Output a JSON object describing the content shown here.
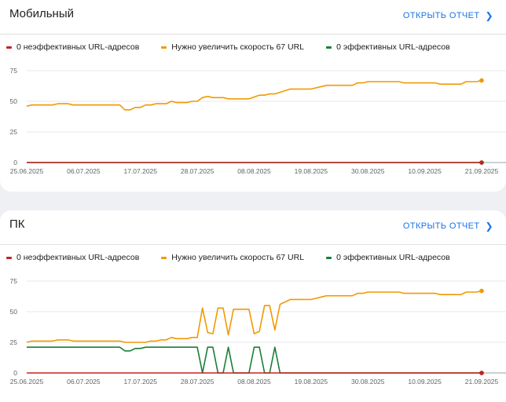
{
  "colors": {
    "red": "#c5221f",
    "orange": "#f29900",
    "green": "#188038",
    "link": "#1a73e8"
  },
  "cards": [
    {
      "title": "Мобильный",
      "link_label": "ОТКРЫТЬ ОТЧЕТ",
      "legend": [
        {
          "label": "0 неэффективных URL-адресов",
          "color": "#c5221f"
        },
        {
          "label": "Нужно увеличить скорость 67 URL",
          "color": "#f29900"
        },
        {
          "label": "0 эффективных URL-адресов",
          "color": "#188038"
        }
      ]
    },
    {
      "title": "ПК",
      "link_label": "ОТКРЫТЬ ОТЧЕТ",
      "legend": [
        {
          "label": "0 неэффективных URL-адресов",
          "color": "#c5221f"
        },
        {
          "label": "Нужно увеличить скорость 67 URL",
          "color": "#f29900"
        },
        {
          "label": "0 эффективных URL-адресов",
          "color": "#188038"
        }
      ]
    }
  ],
  "chart_data": [
    {
      "type": "line",
      "title": "",
      "yticks": [
        0,
        25,
        50,
        75
      ],
      "ylim": [
        0,
        75
      ],
      "xlim": [
        "2025-06-25",
        "2025-09-21"
      ],
      "xticks": [
        "25.06.2025",
        "06.07.2025",
        "17.07.2025",
        "28.07.2025",
        "08.08.2025",
        "19.08.2025",
        "30.08.2025",
        "10.09.2025",
        "21.09.2025"
      ],
      "grid": true,
      "series": [
        {
          "name": "0 неэффективных URL-адресов",
          "color": "#c5221f",
          "points": [
            [
              "2025-06-25",
              0
            ],
            [
              "2025-09-21",
              0
            ]
          ]
        },
        {
          "name": "Нужно увеличить скорость 67 URL",
          "color": "#f29900",
          "points": [
            [
              "2025-06-25",
              46
            ],
            [
              "2025-06-26",
              47
            ],
            [
              "2025-06-30",
              47
            ],
            [
              "2025-07-01",
              48
            ],
            [
              "2025-07-03",
              48
            ],
            [
              "2025-07-04",
              47
            ],
            [
              "2025-07-13",
              47
            ],
            [
              "2025-07-14",
              43
            ],
            [
              "2025-07-15",
              43
            ],
            [
              "2025-07-16",
              45
            ],
            [
              "2025-07-17",
              45
            ],
            [
              "2025-07-18",
              47
            ],
            [
              "2025-07-19",
              47
            ],
            [
              "2025-07-20",
              48
            ],
            [
              "2025-07-22",
              48
            ],
            [
              "2025-07-23",
              50
            ],
            [
              "2025-07-24",
              49
            ],
            [
              "2025-07-26",
              49
            ],
            [
              "2025-07-27",
              50
            ],
            [
              "2025-07-28",
              50
            ],
            [
              "2025-07-29",
              53
            ],
            [
              "2025-07-30",
              54
            ],
            [
              "2025-07-31",
              53
            ],
            [
              "2025-08-02",
              53
            ],
            [
              "2025-08-03",
              52
            ],
            [
              "2025-08-07",
              52
            ],
            [
              "2025-08-09",
              55
            ],
            [
              "2025-08-10",
              55
            ],
            [
              "2025-08-11",
              56
            ],
            [
              "2025-08-12",
              56
            ],
            [
              "2025-08-15",
              60
            ],
            [
              "2025-08-19",
              60
            ],
            [
              "2025-08-22",
              63
            ],
            [
              "2025-08-27",
              63
            ],
            [
              "2025-08-28",
              65
            ],
            [
              "2025-08-29",
              65
            ],
            [
              "2025-08-30",
              66
            ],
            [
              "2025-09-05",
              66
            ],
            [
              "2025-09-06",
              65
            ],
            [
              "2025-09-12",
              65
            ],
            [
              "2025-09-13",
              64
            ],
            [
              "2025-09-17",
              64
            ],
            [
              "2025-09-18",
              66
            ],
            [
              "2025-09-20",
              66
            ],
            [
              "2025-09-21",
              67
            ]
          ]
        },
        {
          "name": "0 эффективных URL-адресов",
          "color": "#188038",
          "points": [
            [
              "2025-06-25",
              0
            ],
            [
              "2025-09-21",
              0
            ]
          ]
        }
      ]
    },
    {
      "type": "line",
      "title": "",
      "yticks": [
        0,
        25,
        50,
        75
      ],
      "ylim": [
        0,
        75
      ],
      "xlim": [
        "2025-06-25",
        "2025-09-21"
      ],
      "xticks": [
        "25.06.2025",
        "06.07.2025",
        "17.07.2025",
        "28.07.2025",
        "08.08.2025",
        "19.08.2025",
        "30.08.2025",
        "10.09.2025",
        "21.09.2025"
      ],
      "grid": true,
      "series": [
        {
          "name": "0 неэффективных URL-адресов",
          "color": "#c5221f",
          "points": [
            [
              "2025-06-25",
              0
            ],
            [
              "2025-09-21",
              0
            ]
          ]
        },
        {
          "name": "Нужно увеличить скорость 67 URL",
          "color": "#f29900",
          "points": [
            [
              "2025-06-25",
              25
            ],
            [
              "2025-06-26",
              26
            ],
            [
              "2025-06-30",
              26
            ],
            [
              "2025-07-01",
              27
            ],
            [
              "2025-07-03",
              27
            ],
            [
              "2025-07-04",
              26
            ],
            [
              "2025-07-13",
              26
            ],
            [
              "2025-07-14",
              25
            ],
            [
              "2025-07-18",
              25
            ],
            [
              "2025-07-19",
              26
            ],
            [
              "2025-07-20",
              26
            ],
            [
              "2025-07-21",
              27
            ],
            [
              "2025-07-22",
              27
            ],
            [
              "2025-07-23",
              29
            ],
            [
              "2025-07-24",
              28
            ],
            [
              "2025-07-26",
              28
            ],
            [
              "2025-07-27",
              29
            ],
            [
              "2025-07-28",
              29
            ],
            [
              "2025-07-29",
              53
            ],
            [
              "2025-07-30",
              33
            ],
            [
              "2025-07-31",
              32
            ],
            [
              "2025-08-01",
              53
            ],
            [
              "2025-08-02",
              53
            ],
            [
              "2025-08-03",
              31
            ],
            [
              "2025-08-04",
              52
            ],
            [
              "2025-08-07",
              52
            ],
            [
              "2025-08-08",
              32
            ],
            [
              "2025-08-09",
              34
            ],
            [
              "2025-08-10",
              55
            ],
            [
              "2025-08-11",
              55
            ],
            [
              "2025-08-12",
              35
            ],
            [
              "2025-08-13",
              56
            ],
            [
              "2025-08-15",
              60
            ],
            [
              "2025-08-19",
              60
            ],
            [
              "2025-08-22",
              63
            ],
            [
              "2025-08-27",
              63
            ],
            [
              "2025-08-28",
              65
            ],
            [
              "2025-08-29",
              65
            ],
            [
              "2025-08-30",
              66
            ],
            [
              "2025-09-05",
              66
            ],
            [
              "2025-09-06",
              65
            ],
            [
              "2025-09-12",
              65
            ],
            [
              "2025-09-13",
              64
            ],
            [
              "2025-09-17",
              64
            ],
            [
              "2025-09-18",
              66
            ],
            [
              "2025-09-20",
              66
            ],
            [
              "2025-09-21",
              67
            ]
          ]
        },
        {
          "name": "0 эффективных URL-адресов",
          "color": "#188038",
          "points": [
            [
              "2025-06-25",
              21
            ],
            [
              "2025-07-13",
              21
            ],
            [
              "2025-07-14",
              18
            ],
            [
              "2025-07-15",
              18
            ],
            [
              "2025-07-16",
              20
            ],
            [
              "2025-07-17",
              20
            ],
            [
              "2025-07-18",
              21
            ],
            [
              "2025-07-28",
              21
            ],
            [
              "2025-07-29",
              0
            ],
            [
              "2025-07-30",
              21
            ],
            [
              "2025-07-31",
              21
            ],
            [
              "2025-08-01",
              0
            ],
            [
              "2025-08-02",
              0
            ],
            [
              "2025-08-03",
              21
            ],
            [
              "2025-08-04",
              0
            ],
            [
              "2025-08-07",
              0
            ],
            [
              "2025-08-08",
              21
            ],
            [
              "2025-08-09",
              21
            ],
            [
              "2025-08-10",
              0
            ],
            [
              "2025-08-11",
              0
            ],
            [
              "2025-08-12",
              21
            ],
            [
              "2025-08-13",
              0
            ],
            [
              "2025-09-21",
              0
            ]
          ]
        }
      ]
    }
  ]
}
